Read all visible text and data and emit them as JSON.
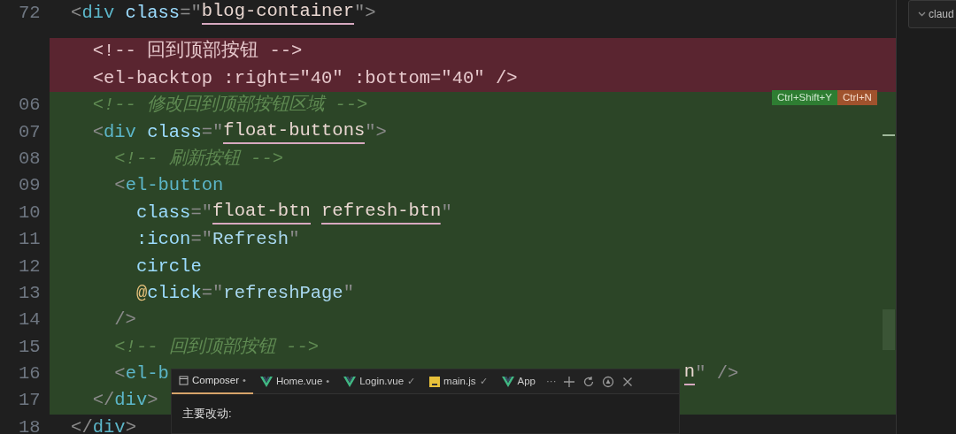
{
  "editor": {
    "lines": [
      {
        "number": "72",
        "kind": "context",
        "tokens": [
          {
            "text": "  <",
            "kind": "punct"
          },
          {
            "text": "div",
            "kind": "tag"
          },
          {
            "text": " class",
            "kind": "attr"
          },
          {
            "text": "=\"",
            "kind": "punct"
          },
          {
            "text": "blog-container",
            "kind": "str-ul"
          },
          {
            "text": "\">",
            "kind": "punct"
          }
        ]
      },
      {
        "kind": "removed",
        "tokens": [
          {
            "text": "    <!-- 回到顶部按钮 -->",
            "kind": "comment-plain"
          }
        ]
      },
      {
        "kind": "removed",
        "tokens": [
          {
            "text": "    <el-backtop :right=\"40\" :bottom=\"40\" />",
            "kind": "comment-plain"
          }
        ]
      },
      {
        "number": "06",
        "kind": "added",
        "tokens": [
          {
            "text": "    <!-- 修改回到顶部按钮区域 -->",
            "kind": "comment"
          }
        ]
      },
      {
        "number": "07",
        "kind": "added",
        "tokens": [
          {
            "text": "    <",
            "kind": "punct"
          },
          {
            "text": "div",
            "kind": "tag"
          },
          {
            "text": " class",
            "kind": "attr"
          },
          {
            "text": "=\"",
            "kind": "punct"
          },
          {
            "text": "float-buttons",
            "kind": "str-ul"
          },
          {
            "text": "\">",
            "kind": "punct"
          }
        ]
      },
      {
        "number": "08",
        "kind": "added",
        "tokens": [
          {
            "text": "      <!-- 刷新按钮 -->",
            "kind": "comment"
          }
        ]
      },
      {
        "number": "09",
        "kind": "added",
        "tokens": [
          {
            "text": "      <",
            "kind": "punct"
          },
          {
            "text": "el-button",
            "kind": "tag"
          }
        ]
      },
      {
        "number": "10",
        "kind": "added",
        "tokens": [
          {
            "text": "        class",
            "kind": "attr"
          },
          {
            "text": "=\"",
            "kind": "punct"
          },
          {
            "text": "float-btn",
            "kind": "str-ul"
          },
          {
            "text": " refresh-btn",
            "kind": "str-ul2"
          },
          {
            "text": "\"",
            "kind": "punct"
          }
        ]
      },
      {
        "number": "11",
        "kind": "added",
        "tokens": [
          {
            "text": "        :icon",
            "kind": "attr"
          },
          {
            "text": "=\"",
            "kind": "punct"
          },
          {
            "text": "Refresh",
            "kind": "str"
          },
          {
            "text": "\"",
            "kind": "punct"
          }
        ]
      },
      {
        "number": "12",
        "kind": "added",
        "tokens": [
          {
            "text": "        circle",
            "kind": "attr"
          }
        ]
      },
      {
        "number": "13",
        "kind": "added",
        "tokens": [
          {
            "text": "        @",
            "kind": "at"
          },
          {
            "text": "click",
            "kind": "attr"
          },
          {
            "text": "=\"",
            "kind": "punct"
          },
          {
            "text": "refreshPage",
            "kind": "str"
          },
          {
            "text": "\"",
            "kind": "punct"
          }
        ]
      },
      {
        "number": "14",
        "kind": "added",
        "tokens": [
          {
            "text": "      />",
            "kind": "punct"
          }
        ]
      },
      {
        "number": "15",
        "kind": "added",
        "tokens": [
          {
            "text": "      <!-- 回到顶部按钮 -->",
            "kind": "comment"
          }
        ]
      },
      {
        "number": "16",
        "kind": "added",
        "tokens": [
          {
            "text": "      <",
            "kind": "punct"
          },
          {
            "text": "el-b",
            "kind": "tag"
          }
        ],
        "tail": [
          {
            "text": "n",
            "kind": "str-ul"
          },
          {
            "text": "\" />",
            "kind": "punct"
          }
        ]
      },
      {
        "number": "17",
        "kind": "added",
        "tokens": [
          {
            "text": "    </",
            "kind": "punct"
          },
          {
            "text": "div",
            "kind": "tag"
          },
          {
            "text": ">",
            "kind": "punct"
          }
        ]
      },
      {
        "number": "18",
        "kind": "context",
        "tokens": [
          {
            "text": "  </",
            "kind": "punct"
          },
          {
            "text": "div",
            "kind": "tag"
          },
          {
            "text": ">",
            "kind": "punct"
          }
        ]
      }
    ],
    "diff_actions": [
      {
        "label": "Ctrl+Shift+Y",
        "kind": "accept"
      },
      {
        "label": "Ctrl+N",
        "kind": "reject"
      }
    ]
  },
  "side_panel": {
    "tab": "claud"
  },
  "composer": {
    "tabs": [
      {
        "label": "Composer",
        "kind": "chat",
        "marker": "•",
        "selected": true
      },
      {
        "label": "Home.vue",
        "kind": "vue",
        "marker": "•",
        "selected": false
      },
      {
        "label": "Login.vue",
        "kind": "vue",
        "marker": "✓",
        "selected": false
      },
      {
        "label": "main.js",
        "kind": "js",
        "marker": "✓",
        "selected": false
      },
      {
        "label": "App",
        "kind": "vue",
        "selected": false
      }
    ],
    "more": "···",
    "body": "主要改动:"
  }
}
